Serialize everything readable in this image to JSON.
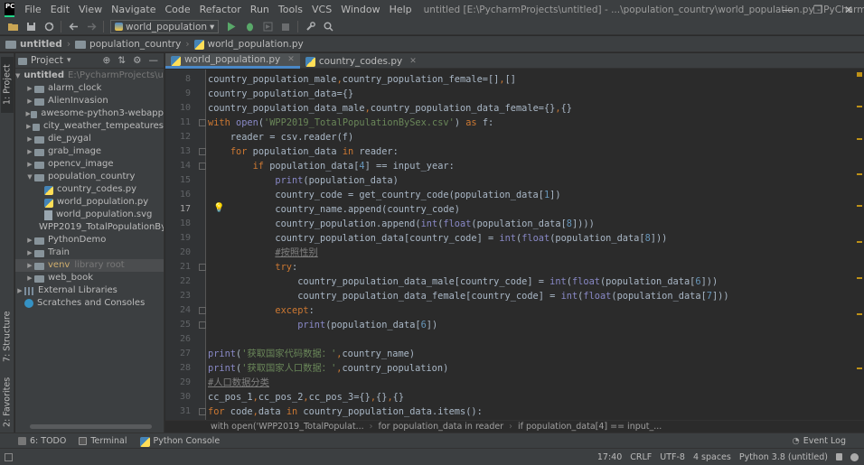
{
  "menubar": {
    "logo_text": "PC",
    "items": [
      "File",
      "Edit",
      "View",
      "Navigate",
      "Code",
      "Refactor",
      "Run",
      "Tools",
      "VCS",
      "Window",
      "Help"
    ],
    "window_title": "untitled [E:\\PycharmProjects\\untitled] - ...\\population_country\\world_population.py - PyCharm",
    "window_controls": {
      "minimize": "—",
      "restore": "❐",
      "close": "✕"
    }
  },
  "toolbar": {
    "run_config": "world_population",
    "run_config_arrow": "▾"
  },
  "breadcrumb": {
    "items": [
      "untitled",
      "population_country",
      "world_population.py"
    ]
  },
  "left_stripe": {
    "tabs": [
      "1: Project",
      "7: Structure",
      "2: Favorites"
    ]
  },
  "project_panel": {
    "header_label": "Project",
    "root": {
      "name": "untitled",
      "path": "E:\\PycharmProjects\\untitl"
    },
    "items": [
      {
        "name": "alarm_clock",
        "type": "folder",
        "level": 1,
        "arrow": "▶"
      },
      {
        "name": "AlienInvasion",
        "type": "folder",
        "level": 1,
        "arrow": "▶"
      },
      {
        "name": "awesome-python3-webapp",
        "type": "folder",
        "level": 1,
        "arrow": "▶"
      },
      {
        "name": "city_weather_tempeatures",
        "type": "folder",
        "level": 1,
        "arrow": "▶"
      },
      {
        "name": "die_pygal",
        "type": "folder",
        "level": 1,
        "arrow": "▶"
      },
      {
        "name": "grab_image",
        "type": "folder",
        "level": 1,
        "arrow": "▶"
      },
      {
        "name": "opencv_image",
        "type": "folder",
        "level": 1,
        "arrow": "▶"
      },
      {
        "name": "population_country",
        "type": "folder",
        "level": 1,
        "arrow": "▼"
      },
      {
        "name": "country_codes.py",
        "type": "py",
        "level": 2,
        "arrow": ""
      },
      {
        "name": "world_population.py",
        "type": "py",
        "level": 2,
        "arrow": ""
      },
      {
        "name": "world_population.svg",
        "type": "file",
        "level": 2,
        "arrow": ""
      },
      {
        "name": "WPP2019_TotalPopulationBy",
        "type": "csv",
        "level": 2,
        "arrow": ""
      },
      {
        "name": "PythonDemo",
        "type": "folder",
        "level": 1,
        "arrow": "▶"
      },
      {
        "name": "Train",
        "type": "folder",
        "level": 1,
        "arrow": "▶"
      },
      {
        "name": "venv",
        "type": "folder",
        "level": 1,
        "arrow": "▶",
        "suffix": "library root",
        "excluded": true
      },
      {
        "name": "web_book",
        "type": "folder",
        "level": 1,
        "arrow": "▶"
      },
      {
        "name": "External Libraries",
        "type": "lib",
        "level": 0,
        "arrow": "▶"
      },
      {
        "name": "Scratches and Consoles",
        "type": "scratch",
        "level": 0,
        "arrow": ""
      }
    ]
  },
  "editor_tabs": [
    {
      "label": "world_population.py",
      "active": true
    },
    {
      "label": "country_codes.py",
      "active": false
    }
  ],
  "editor": {
    "current_line": "17",
    "lines": [
      {
        "n": "8",
        "text": "country_population_male,country_population_female=[],[]"
      },
      {
        "n": "9",
        "text": "country_population_data={}"
      },
      {
        "n": "10",
        "text": "country_population_data_male,country_population_data_female={},{}"
      },
      {
        "n": "11",
        "text": "with open('WPP2019_TotalPopulationBySex.csv') as f:"
      },
      {
        "n": "12",
        "text": "    reader = csv.reader(f)"
      },
      {
        "n": "13",
        "text": "    for population_data in reader:"
      },
      {
        "n": "14",
        "text": "        if population_data[4] == input_year:"
      },
      {
        "n": "15",
        "text": "            print(population_data)"
      },
      {
        "n": "16",
        "text": "            country_code = get_country_code(population_data[1])"
      },
      {
        "n": "17",
        "text": "            country_name.append(country_code)"
      },
      {
        "n": "18",
        "text": "            country_population.append(int(float(population_data[8])))"
      },
      {
        "n": "19",
        "text": "            country_population_data[country_code] = int(float(population_data[8]))"
      },
      {
        "n": "20",
        "text": "            #按照性别"
      },
      {
        "n": "21",
        "text": "            try:"
      },
      {
        "n": "22",
        "text": "                country_population_data_male[country_code] = int(float(population_data[6]))"
      },
      {
        "n": "23",
        "text": "                country_population_data_female[country_code] = int(float(population_data[7]))"
      },
      {
        "n": "24",
        "text": "            except:"
      },
      {
        "n": "25",
        "text": "                print(population_data[6])"
      },
      {
        "n": "26",
        "text": ""
      },
      {
        "n": "27",
        "text": "print('获取国家代码数据：',country_name)"
      },
      {
        "n": "28",
        "text": "print('获取国家人口数据：',country_population)"
      },
      {
        "n": "29",
        "text": "#人口数据分类"
      },
      {
        "n": "30",
        "text": "cc_pos_1,cc_pos_2,cc_pos_3={},{},{}"
      },
      {
        "n": "31",
        "text": "for code,data in country_population_data.items():"
      }
    ]
  },
  "editor_crumbs": [
    "with open('WPP2019_TotalPopulat...",
    "for population_data in reader",
    "if population_data[4] == input_..."
  ],
  "bottom_tools": {
    "todo": "6: TODO",
    "terminal": "Terminal",
    "python_console": "Python Console",
    "event_log": "Event Log"
  },
  "statusbar": {
    "position": "17:40",
    "line_sep": "CRLF",
    "encoding": "UTF-8",
    "indent": "4 spaces",
    "interpreter": "Python 3.8 (untitled)"
  },
  "colors": {
    "keyword": "#cc7832",
    "string": "#6a8759",
    "builtin": "#8888c6",
    "comment": "#808080",
    "number": "#6897bb",
    "accent": "#4a88c7"
  }
}
